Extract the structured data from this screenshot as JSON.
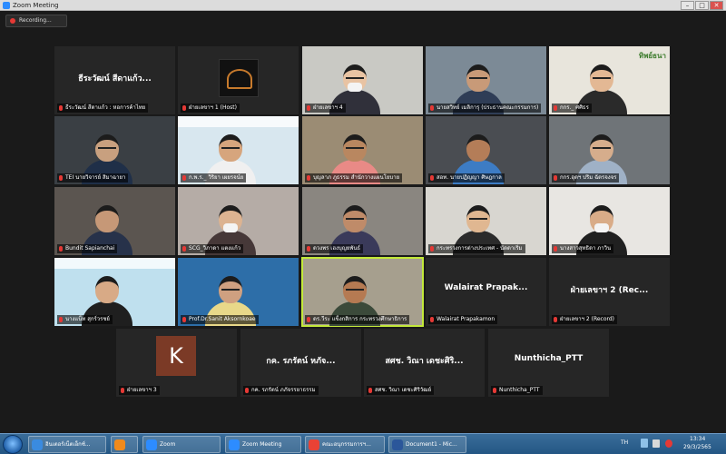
{
  "window": {
    "title": "Zoom Meeting",
    "controls": [
      "–",
      "□",
      "✕"
    ]
  },
  "recording": {
    "label": "Recording..."
  },
  "tiles": [
    {
      "name": "ธีระวัฒน์ สีดาแก้ว : หอการค้าไทย",
      "big": "ธีระวัฒน์ สีดาแก้ว...",
      "type": "blank"
    },
    {
      "name": "ฝ่ายเลขาฯ 1 (Host)",
      "type": "logo"
    },
    {
      "name": "ฝ่ายเลขาฯ 4",
      "type": "person",
      "bg": "#c9c9c4",
      "skin": "#e8c3a3",
      "shirt": "#30303a",
      "mask": true,
      "glasses": true
    },
    {
      "name": "นายสวิทย์ เมลิการุ (ประธานคณะกรรมการ)",
      "type": "person",
      "bg": "#7c8a96",
      "skin": "#c89a78",
      "shirt": "#2f3d56",
      "glasses": true
    },
    {
      "name": "กกร._ ศศิธร",
      "type": "person",
      "bg": "#e8e5dc",
      "skin": "#e3b894",
      "shirt": "#2a2a2a",
      "glasses": true,
      "logo": "ทิพย์ธนา"
    },
    {
      "name": "TEI นายวิจารย์ สิมาฉายา",
      "type": "person",
      "bg": "#3a3f44",
      "skin": "#c8a07f",
      "shirt": "#1f2f48",
      "glasses": true
    },
    {
      "name": "ก.พ.ร._ วิริยา เผยรจน์ย",
      "type": "person",
      "bg": "#d8e7ef",
      "skin": "#d6a57d",
      "shirt": "#f0f0f0",
      "glasses": true,
      "banner": true
    },
    {
      "name": "บุญลาภ ภูธรรม สำนักวางแผนโยบาย",
      "type": "person",
      "bg": "#9b8c74",
      "skin": "#b98760",
      "shirt": "#e98a86",
      "glasses": true
    },
    {
      "name": "สอท. นายปฏิญญา ศิษฎกาล",
      "type": "person",
      "bg": "#4a4d52",
      "skin": "#b47d58",
      "shirt": "#3d7cc4"
    },
    {
      "name": "กกร.อุตฯ ปริม ฉัตรจงจร",
      "type": "person",
      "bg": "#6f7478",
      "skin": "#d6ad8c",
      "shirt": "#9fb1c6",
      "glasses": true
    },
    {
      "name": "Bundit Sapianchai",
      "type": "person",
      "bg": "#5b5550",
      "skin": "#c69877",
      "shirt": "#27324a"
    },
    {
      "name": "SCG_วิภาดา แตงแก้ว",
      "type": "person",
      "bg": "#b5aca6",
      "skin": "#dcb391",
      "shirt": "#463838",
      "mask": true
    },
    {
      "name": "ดวงพร เฮงบุญยพันธ์",
      "type": "person",
      "bg": "#8a8680",
      "skin": "#bf8b69",
      "shirt": "#3a3a5a",
      "glasses": true
    },
    {
      "name": "กระทรวงการต่างประเทศ - นัดดาเริ่ม",
      "type": "person",
      "bg": "#d8d6d0",
      "skin": "#e0b791",
      "shirt": "#2b2b2b",
      "glasses": true
    },
    {
      "name": "นางสาวสุทธิดา ภาวิน",
      "type": "person",
      "bg": "#e8e6e2",
      "skin": "#d9ac88",
      "shirt": "#202020",
      "mask": true
    },
    {
      "name": "นางแน็ท สุกร์วรชย์",
      "type": "person",
      "bg": "#bfe0ee",
      "skin": "#d8aa86",
      "shirt": "#1f1f1f",
      "banner": true
    },
    {
      "name": "Prof.Dr.Sanit Aksornkoae",
      "type": "person",
      "bg": "#2d6ea8",
      "skin": "#cfa080",
      "shirt": "#e8d889",
      "glasses": true
    },
    {
      "name": "ดร.วีระ แข็งกสิการ กระทรวงศึกษาธิการ",
      "type": "person",
      "bg": "#a69f8e",
      "skin": "#b57a52",
      "shirt": "#3b4a3a",
      "glasses": true,
      "active": true
    },
    {
      "name": "Walairat Prapakamon",
      "big": "Walairat  Prapak...",
      "type": "blank"
    },
    {
      "name": "ฝ่ายเลขาฯ 2 (Record)",
      "big": "ฝ่ายเลขาฯ 2 (Rec...",
      "type": "blank"
    },
    {
      "name": "ฝ่ายเลขาฯ 3",
      "type": "avatar",
      "initial": "K"
    },
    {
      "name": "กค. รภรัตน์ ภภัจรรยาธรรม",
      "big": "กค. รภรัตน์ หภัจ...",
      "type": "blank"
    },
    {
      "name": "สศช. วิณา เดชะศิริวัฒย์",
      "big": "สศช. วิณา เดชะศิริ...",
      "type": "blank"
    },
    {
      "name": "Nunthicha_PTT",
      "big": "Nunthicha_PTT",
      "type": "blank"
    }
  ],
  "taskbar": {
    "items": [
      {
        "label": "อินเตอร์เน็ตเอ็กซ์...",
        "color": "#3a8be0"
      },
      {
        "label": "",
        "color": "#f08a1c"
      },
      {
        "label": "Zoom",
        "color": "#2d8cff"
      },
      {
        "label": "Zoom Meeting",
        "color": "#2d8cff"
      },
      {
        "label": "คณะอนุกรรมการฯ...",
        "color": "#e94235"
      },
      {
        "label": "Document1 - Mic...",
        "color": "#2b579a"
      }
    ],
    "lang": "TH",
    "time": "13:34",
    "date": "29/3/2565"
  }
}
